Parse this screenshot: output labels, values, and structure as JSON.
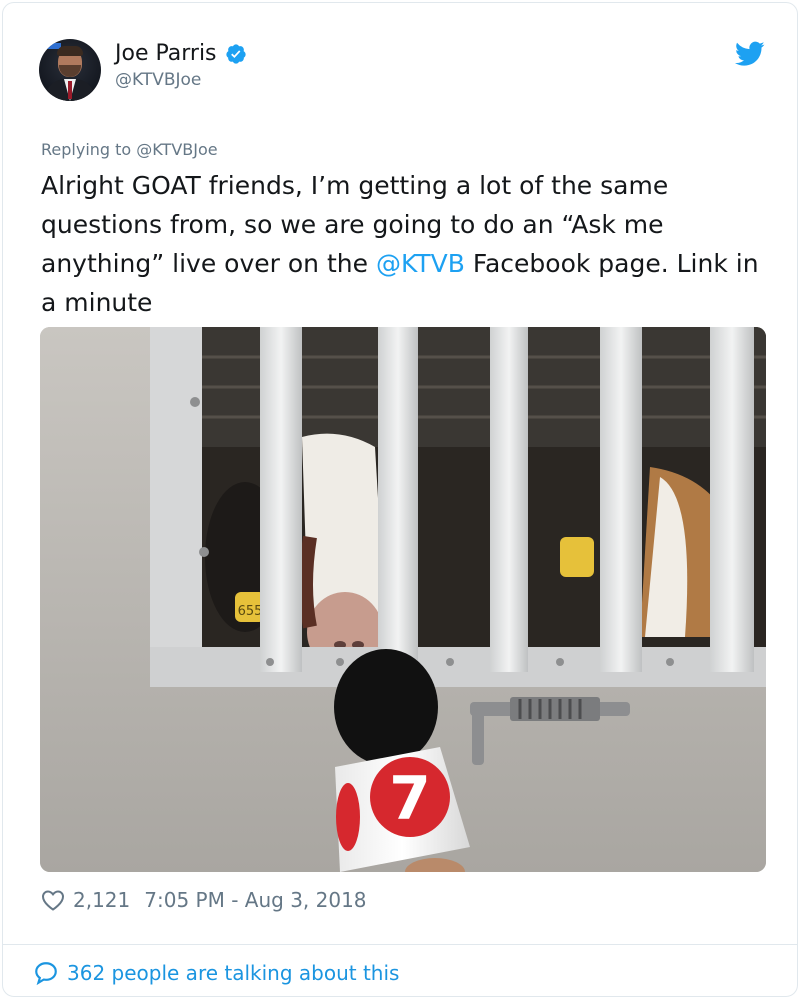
{
  "author": {
    "name": "Joe Parris",
    "handle": "@KTVBJoe",
    "verified": true
  },
  "reply": {
    "prefix": "Replying to ",
    "mention": "@KTVBJoe"
  },
  "tweet": {
    "text_before": "Alright GOAT friends, I’m getting a lot of the same questions from, so we are going to do an “Ask me anything” live over on the ",
    "link": "@KTVB",
    "text_after": " Facebook page. Link in a minute"
  },
  "photo": {
    "ear_tag": "655",
    "mic_flag_number": "7"
  },
  "stats": {
    "likes": "2,121",
    "timestamp": "7:05 PM - Aug 3, 2018"
  },
  "conversation": {
    "label": "362 people are talking about this"
  },
  "colors": {
    "link": "#1da1f2",
    "secondary": "#657786",
    "conversation": "#1b95e0"
  }
}
